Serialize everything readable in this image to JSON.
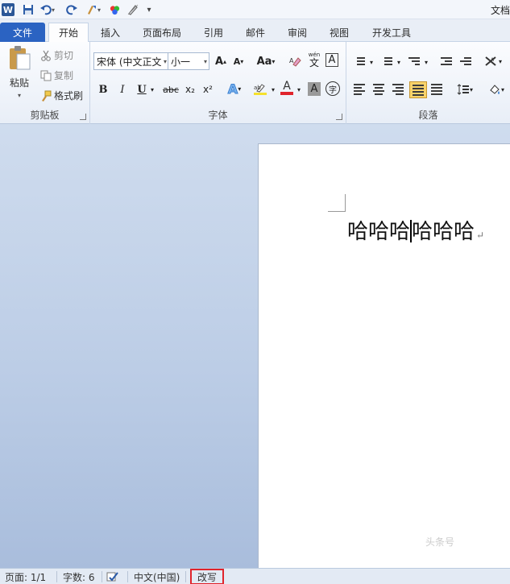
{
  "window": {
    "title": "文档"
  },
  "quick_access": {
    "logo": "W",
    "icons": [
      "word-logo-icon",
      "save-icon",
      "undo-icon",
      "redo-icon",
      "format-painter-icon",
      "color-wheel-icon",
      "pen-icon",
      "customize-icon"
    ]
  },
  "tabs": [
    {
      "label": "文件"
    },
    {
      "label": "开始"
    },
    {
      "label": "插入"
    },
    {
      "label": "页面布局"
    },
    {
      "label": "引用"
    },
    {
      "label": "邮件"
    },
    {
      "label": "审阅"
    },
    {
      "label": "视图"
    },
    {
      "label": "开发工具"
    }
  ],
  "ribbon": {
    "clipboard": {
      "label": "剪贴板",
      "paste": "粘贴",
      "cut": "剪切",
      "copy": "复制",
      "format_painter": "格式刷"
    },
    "font": {
      "label": "字体",
      "font_name": "宋体 (中文正文)",
      "font_size": "小一",
      "grow": "A",
      "shrink": "A",
      "change_case": "Aa",
      "pinyin": "wén",
      "border_char": "A",
      "bold": "B",
      "italic": "I",
      "underline": "U",
      "strikethrough": "abc",
      "subscript": "x₂",
      "superscript": "x²",
      "font_color": "A",
      "char_shading": "A",
      "enclose": "字"
    },
    "paragraph": {
      "label": "段落"
    }
  },
  "document": {
    "text_before_caret": "哈哈哈",
    "text_after_caret": "哈哈哈",
    "paragraph_mark": "↵"
  },
  "watermark": "头条号",
  "status": {
    "page": "页面: 1/1",
    "words": "字数: 6",
    "language": "中文(中国)",
    "mode": "改写"
  },
  "colors": {
    "file_tab": "#2b63c2",
    "font_color_bar": "#e0242c",
    "highlight_bar": "#f6e12d",
    "overtype_box": "#e0242c"
  }
}
